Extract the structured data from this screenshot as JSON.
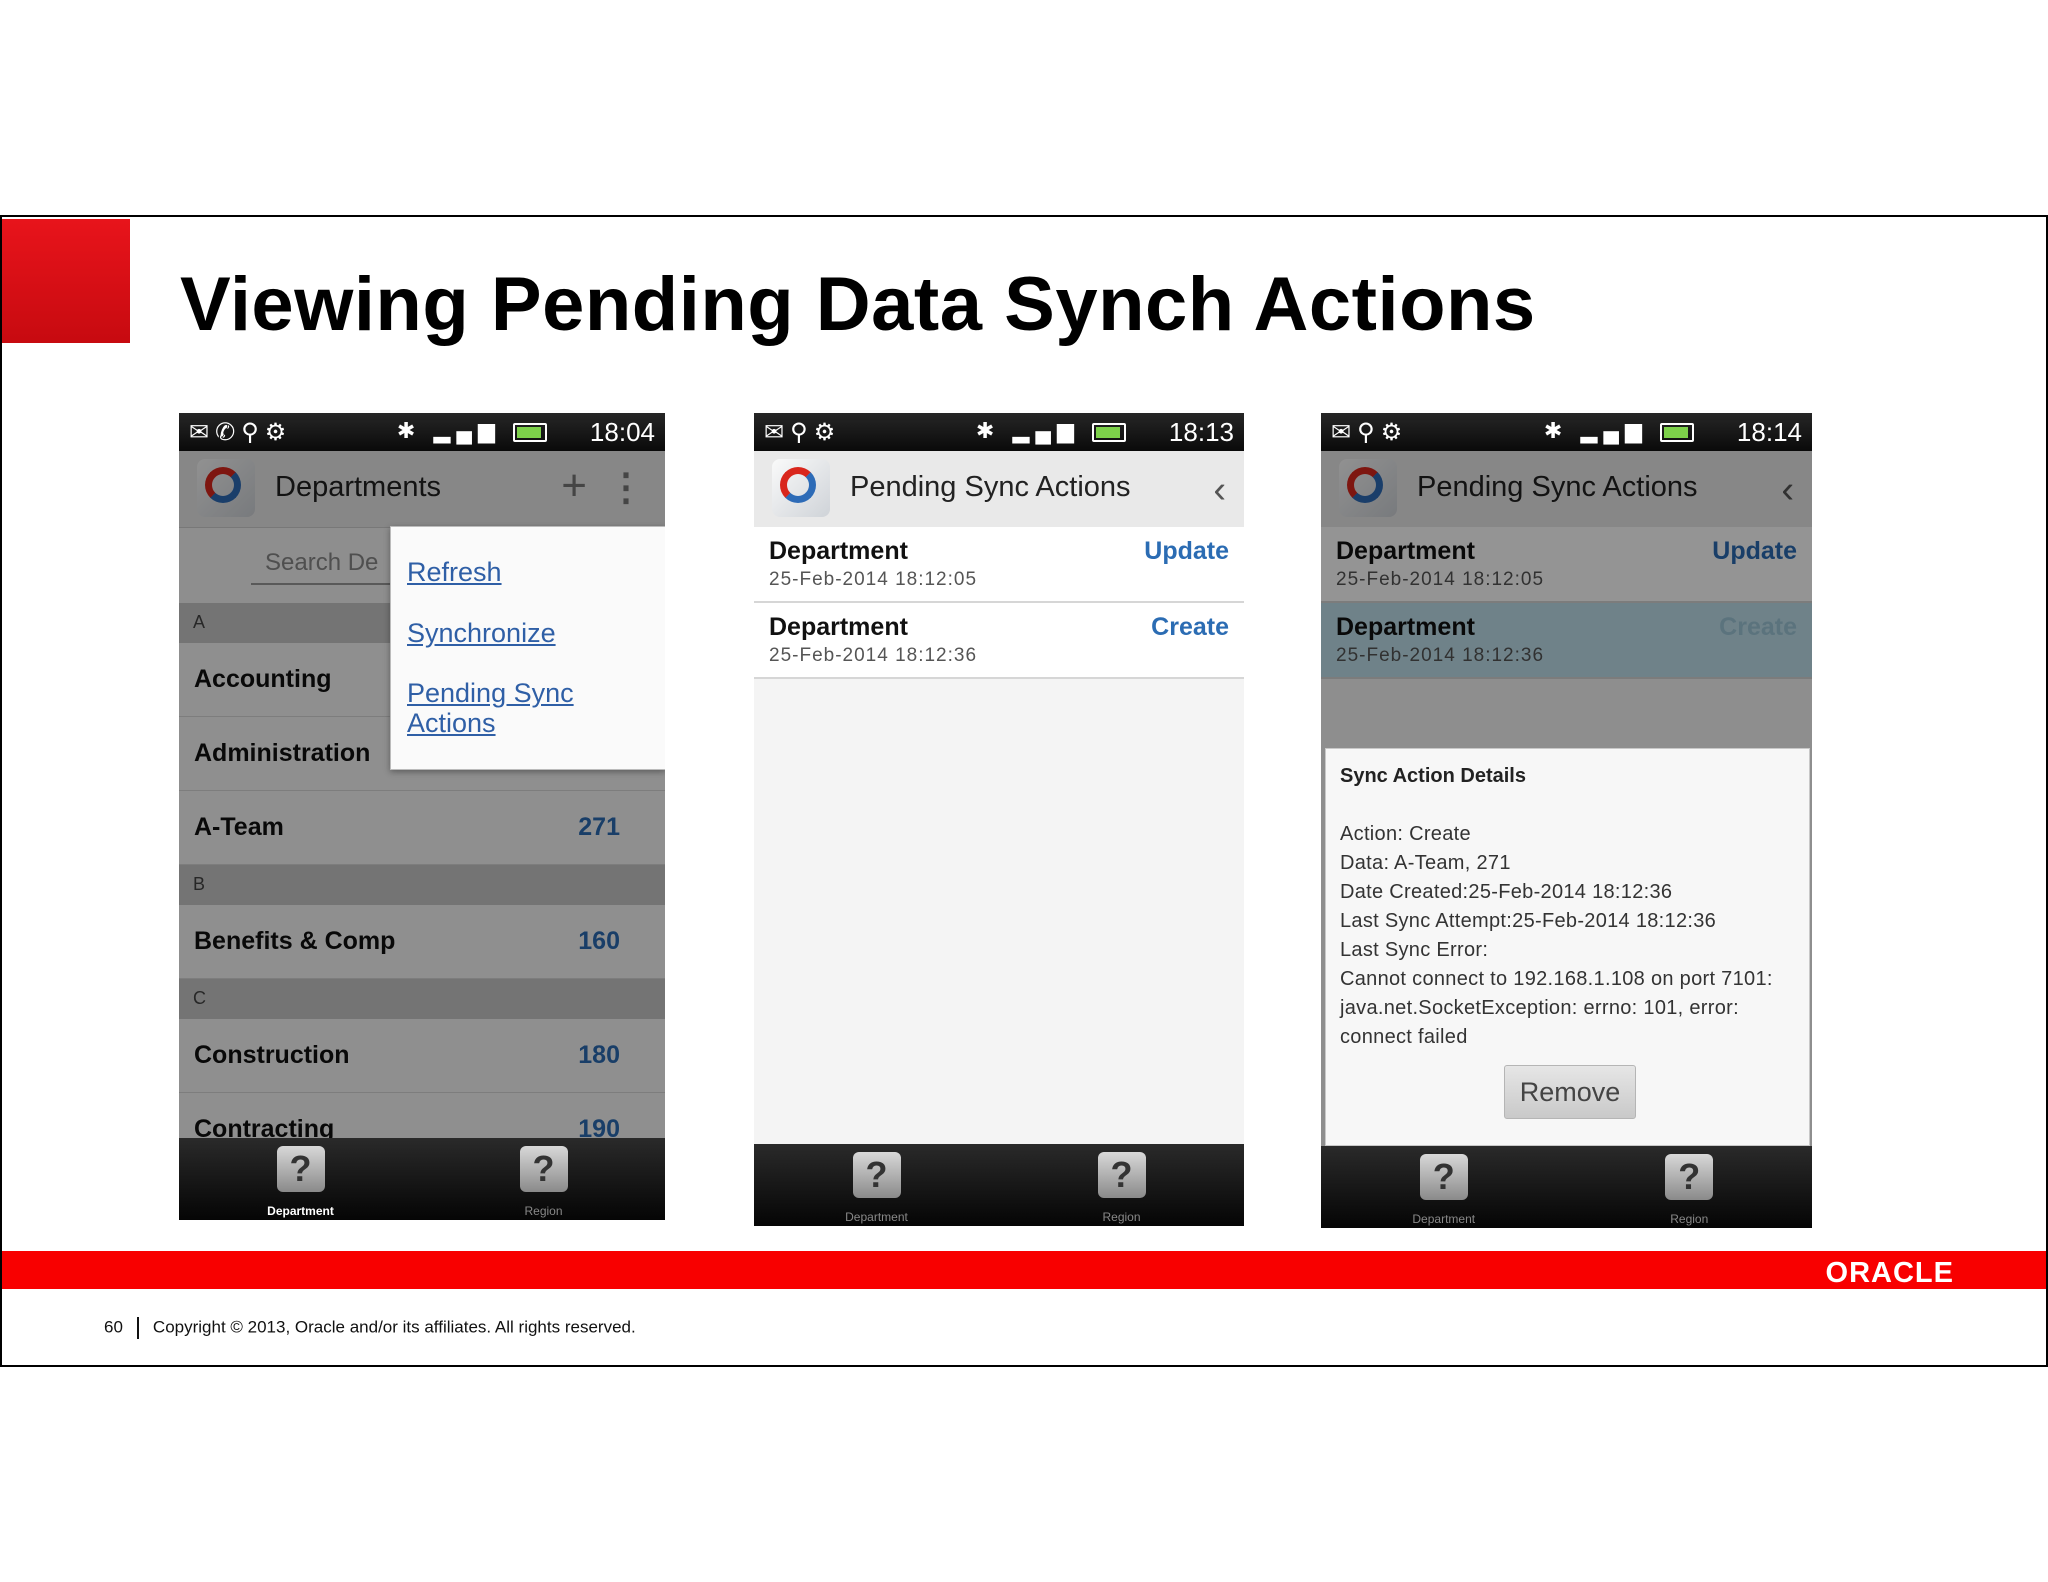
{
  "slide": {
    "title": "Viewing Pending Data Synch Actions",
    "page_number": "60",
    "copyright": "Copyright © 2013, Oracle and/or its affiliates. All rights reserved.",
    "logo_text": "ORACLE",
    "colors": {
      "accent_red": "#f80000",
      "link_blue": "#2b6cb3"
    }
  },
  "phone1": {
    "time": "18:04",
    "title": "Departments",
    "search_placeholder": "Search De",
    "menu": [
      "Refresh",
      "Synchronize",
      "Pending Sync",
      "Actions"
    ],
    "sections": [
      "A",
      "B",
      "C"
    ],
    "rows": [
      {
        "name": "Accounting",
        "count": ""
      },
      {
        "name": "Administration",
        "count": ""
      },
      {
        "name": "A-Team",
        "count": "271"
      },
      {
        "name": "Benefits & Comp",
        "count": "160"
      },
      {
        "name": "Construction",
        "count": "180"
      },
      {
        "name": "Contracting",
        "count": "190"
      }
    ],
    "tabs": [
      "Department",
      "Region"
    ]
  },
  "phone2": {
    "time": "18:13",
    "title": "Pending Sync Actions",
    "items": [
      {
        "name": "Department",
        "date": "25-Feb-2014 18:12:05",
        "action": "Update"
      },
      {
        "name": "Department",
        "date": "25-Feb-2014 18:12:36",
        "action": "Create"
      }
    ],
    "tabs": [
      "Department",
      "Region"
    ]
  },
  "phone3": {
    "time": "18:14",
    "title": "Pending Sync Actions",
    "items": [
      {
        "name": "Department",
        "date": "25-Feb-2014 18:12:05",
        "action": "Update"
      },
      {
        "name": "Department",
        "date": "25-Feb-2014 18:12:36",
        "action": "Create"
      }
    ],
    "dialog": {
      "title": "Sync Action Details",
      "lines": [
        "Action: Create",
        "Data: A-Team, 271",
        "Date Created:25-Feb-2014 18:12:36",
        "Last Sync Attempt:25-Feb-2014 18:12:36",
        "Last Sync Error:",
        "Cannot connect to 192.168.1.108 on port 7101:",
        "java.net.SocketException: errno: 101, error:",
        "connect failed"
      ],
      "remove_label": "Remove"
    },
    "tabs": [
      "Department",
      "Region"
    ]
  },
  "icons": [
    "status-icons",
    "bluetooth-icon",
    "signal-icon",
    "battery-icon",
    "app-logo-icon",
    "back-icon",
    "plus-icon",
    "overflow-menu-icon",
    "help-tab-icon"
  ]
}
